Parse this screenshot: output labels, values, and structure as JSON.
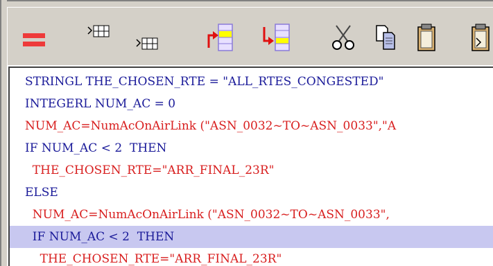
{
  "toolbar": {
    "buttons": [
      {
        "name": "equals-icon",
        "label": "Equals"
      },
      {
        "name": "insert-row-above-icon",
        "label": "Insert row above"
      },
      {
        "name": "insert-row-below-icon",
        "label": "Insert row below"
      },
      {
        "name": "move-up-icon",
        "label": "Move up"
      },
      {
        "name": "move-down-icon",
        "label": "Move down"
      },
      {
        "name": "scissors-icon",
        "label": "Cut"
      },
      {
        "name": "copy-icon",
        "label": "Copy"
      },
      {
        "name": "clipboard-icon",
        "label": "Paste"
      },
      {
        "name": "paste-special-icon",
        "label": "Paste special"
      }
    ]
  },
  "editor": {
    "lines": [
      {
        "text": "STRINGL THE_CHOSEN_RTE = \"ALL_RTES_CONGESTED\"",
        "color": "blue",
        "highlight": false
      },
      {
        "text": "INTEGERL NUM_AC = 0",
        "color": "blue",
        "highlight": false
      },
      {
        "text": "NUM_AC=NumAcOnAirLink (\"ASN_0032~TO~ASN_0033\",\"A",
        "color": "red",
        "highlight": false
      },
      {
        "text": "IF NUM_AC < 2  THEN",
        "color": "blue",
        "highlight": false
      },
      {
        "text": "  THE_CHOSEN_RTE=\"ARR_FINAL_23R\"",
        "color": "red",
        "highlight": false
      },
      {
        "text": "ELSE",
        "color": "blue",
        "highlight": false
      },
      {
        "text": "  NUM_AC=NumAcOnAirLink (\"ASN_0032~TO~ASN_0033\",",
        "color": "red",
        "highlight": false
      },
      {
        "text": "  IF NUM_AC < 2  THEN",
        "color": "blue",
        "highlight": true
      },
      {
        "text": "    THE_CHOSEN_RTE=\"ARR_FINAL_23R\"",
        "color": "red",
        "highlight": false
      }
    ]
  },
  "colors": {
    "blue_text": "#1a1a99",
    "red_text": "#d81e1e",
    "highlight": "#c8c8f0",
    "toolbar_bg": "#d4d0c8"
  }
}
